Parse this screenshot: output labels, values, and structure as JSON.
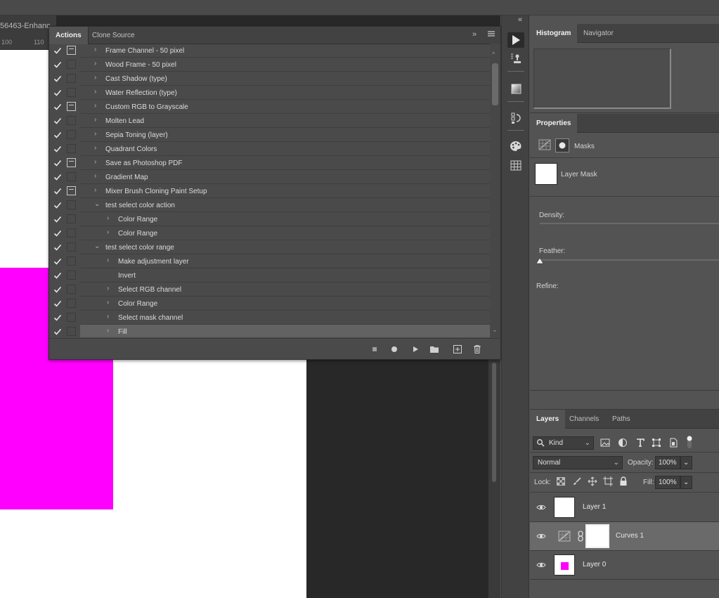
{
  "document": {
    "tab_title": "56463-Enhanc",
    "ruler_ticks": [
      "100",
      "110"
    ],
    "colors": {
      "canvas": "#ffffff",
      "magenta": "#ff00ff",
      "pasteboard": "#282828"
    }
  },
  "actions_panel": {
    "tabs": [
      "Actions",
      "Clone Source"
    ],
    "active_tab": "Actions",
    "items": [
      {
        "label": "Frame Channel - 50 pixel",
        "level": 1,
        "expanded": false,
        "dialog": true,
        "selected": false
      },
      {
        "label": "Wood Frame - 50 pixel",
        "level": 1,
        "expanded": false,
        "dialog": false,
        "selected": false
      },
      {
        "label": "Cast Shadow (type)",
        "level": 1,
        "expanded": false,
        "dialog": false,
        "selected": false
      },
      {
        "label": "Water Reflection (type)",
        "level": 1,
        "expanded": false,
        "dialog": false,
        "selected": false
      },
      {
        "label": "Custom RGB to Grayscale",
        "level": 1,
        "expanded": false,
        "dialog": true,
        "selected": false
      },
      {
        "label": "Molten Lead",
        "level": 1,
        "expanded": false,
        "dialog": false,
        "selected": false
      },
      {
        "label": "Sepia Toning (layer)",
        "level": 1,
        "expanded": false,
        "dialog": false,
        "selected": false
      },
      {
        "label": "Quadrant Colors",
        "level": 1,
        "expanded": false,
        "dialog": false,
        "selected": false
      },
      {
        "label": "Save as Photoshop PDF",
        "level": 1,
        "expanded": false,
        "dialog": true,
        "selected": false
      },
      {
        "label": "Gradient Map",
        "level": 1,
        "expanded": false,
        "dialog": false,
        "selected": false
      },
      {
        "label": "Mixer Brush Cloning Paint Setup",
        "level": 1,
        "expanded": false,
        "dialog": true,
        "selected": false
      },
      {
        "label": "test select color action",
        "level": 1,
        "expanded": true,
        "dialog": false,
        "selected": false
      },
      {
        "label": "Color Range",
        "level": 2,
        "expanded": false,
        "dialog": false,
        "selected": false
      },
      {
        "label": "Color Range",
        "level": 2,
        "expanded": false,
        "dialog": false,
        "selected": false
      },
      {
        "label": "test select color range",
        "level": 1,
        "expanded": true,
        "dialog": false,
        "selected": false
      },
      {
        "label": "Make adjustment layer",
        "level": 2,
        "expanded": false,
        "dialog": false,
        "selected": false
      },
      {
        "label": "Invert",
        "level": 2,
        "expanded": null,
        "dialog": false,
        "selected": false
      },
      {
        "label": "Select RGB channel",
        "level": 2,
        "expanded": false,
        "dialog": false,
        "selected": false
      },
      {
        "label": "Color Range",
        "level": 2,
        "expanded": false,
        "dialog": false,
        "selected": false
      },
      {
        "label": "Select mask channel",
        "level": 2,
        "expanded": false,
        "dialog": false,
        "selected": false
      },
      {
        "label": "Fill",
        "level": 2,
        "expanded": false,
        "dialog": false,
        "selected": true
      }
    ],
    "footer_buttons": [
      "stop-playing-icon",
      "record-icon",
      "play-icon",
      "new-set-icon",
      "new-action-icon",
      "delete-icon"
    ]
  },
  "histogram_panel": {
    "tabs": [
      "Histogram",
      "Navigator"
    ],
    "active_tab": "Histogram"
  },
  "properties_panel": {
    "tab": "Properties",
    "section": "Masks",
    "mask_name": "Layer Mask",
    "density_label": "Density:",
    "feather_label": "Feather:",
    "refine_label": "Refine:"
  },
  "layers_panel": {
    "tabs": [
      "Layers",
      "Channels",
      "Paths"
    ],
    "active_tab": "Layers",
    "filter_kind": "Kind",
    "blend_mode": "Normal",
    "opacity_label": "Opacity:",
    "opacity_value": "100%",
    "lock_label": "Lock:",
    "fill_label": "Fill:",
    "fill_value": "100%",
    "layers": [
      {
        "name": "Layer 1",
        "type": "transparent",
        "selected": false
      },
      {
        "name": "Curves 1",
        "type": "adjustment",
        "selected": true
      },
      {
        "name": "Layer 0",
        "type": "magenta",
        "selected": false
      }
    ]
  }
}
